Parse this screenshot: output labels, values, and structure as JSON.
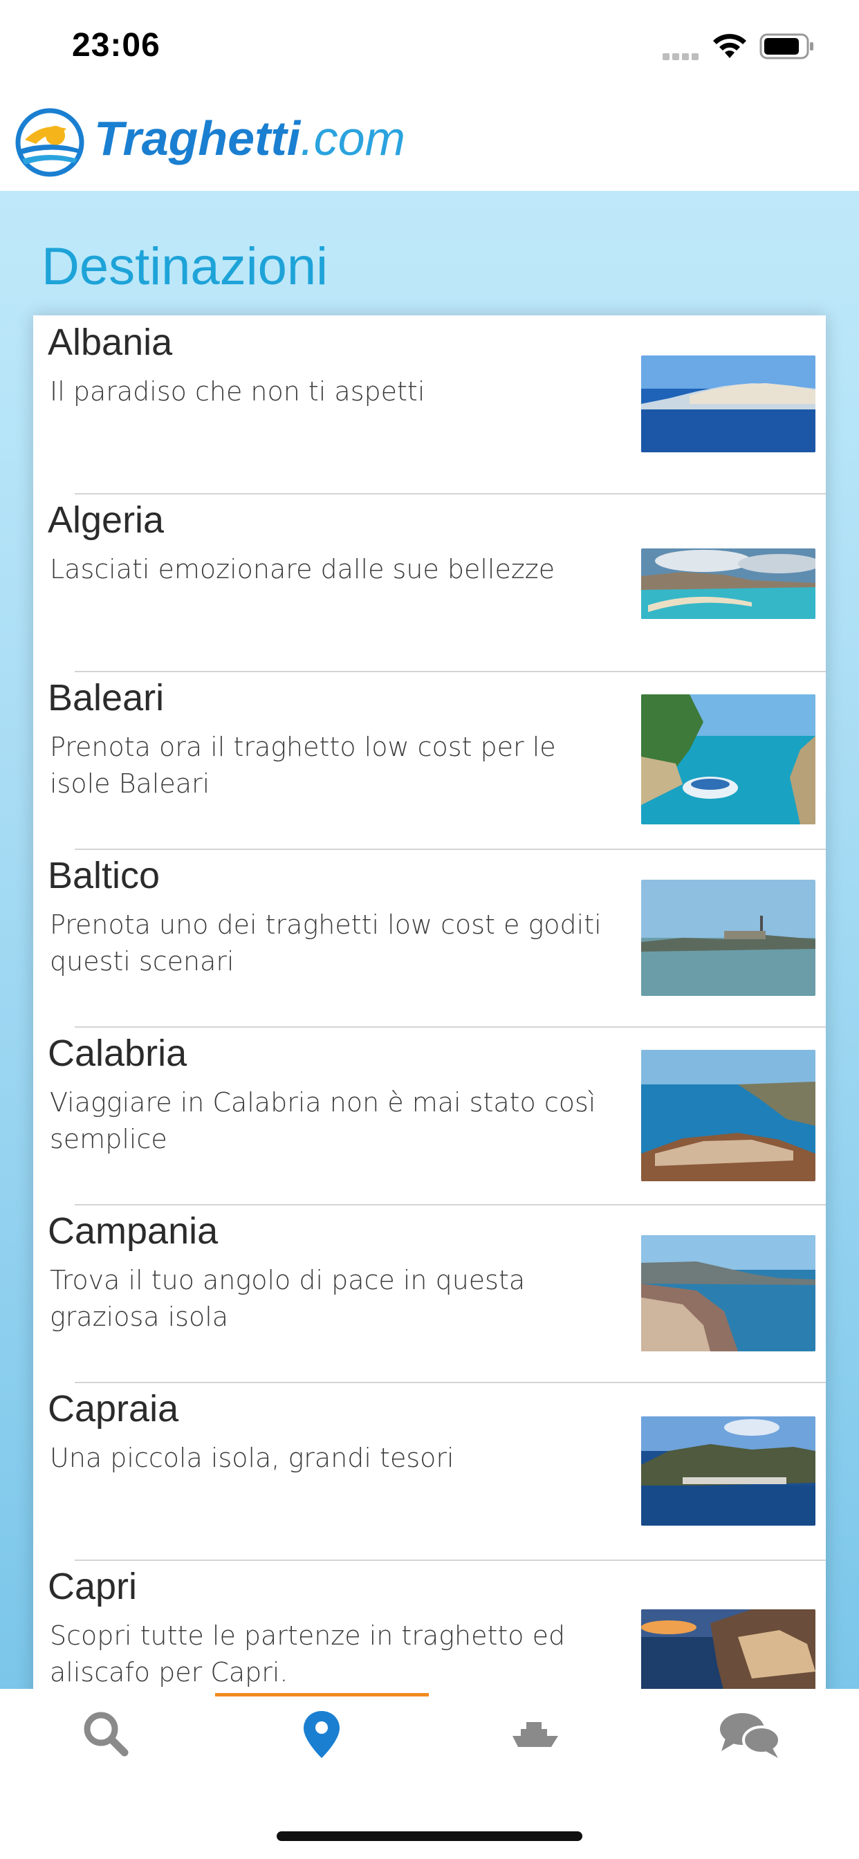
{
  "status": {
    "time": "23:06"
  },
  "brand": {
    "name_bold": "Traghetti",
    "name_light": ".com"
  },
  "page": {
    "title": "Destinazioni"
  },
  "destinations": [
    {
      "title": "Albania",
      "desc": "Il paradiso che non ti aspetti"
    },
    {
      "title": "Algeria",
      "desc": "Lasciati emozionare dalle sue bellezze"
    },
    {
      "title": "Baleari",
      "desc": "Prenota ora il traghetto low cost per le isole Baleari"
    },
    {
      "title": "Baltico",
      "desc": "Prenota uno dei traghetti low cost e goditi questi scenari"
    },
    {
      "title": "Calabria",
      "desc": "Viaggiare in Calabria non è mai stato così semplice"
    },
    {
      "title": "Campania",
      "desc": "Trova il tuo angolo di pace in questa graziosa isola"
    },
    {
      "title": "Capraia",
      "desc": "Una piccola isola, grandi tesori"
    },
    {
      "title": "Capri",
      "desc": "Scopri tutte le partenze in traghetto ed aliscafo per Capri."
    }
  ],
  "tabs": [
    {
      "icon": "search-icon",
      "active": false
    },
    {
      "icon": "map-pin-icon",
      "active": true
    },
    {
      "icon": "ship-icon",
      "active": false
    },
    {
      "icon": "chat-icon",
      "active": false
    }
  ],
  "colors": {
    "accent": "#1a7fd1",
    "title": "#1ea3d8",
    "tab_active": "#1a7fd1",
    "tab_inactive": "#8a8a8a",
    "tab_indicator": "#f18a1f"
  }
}
